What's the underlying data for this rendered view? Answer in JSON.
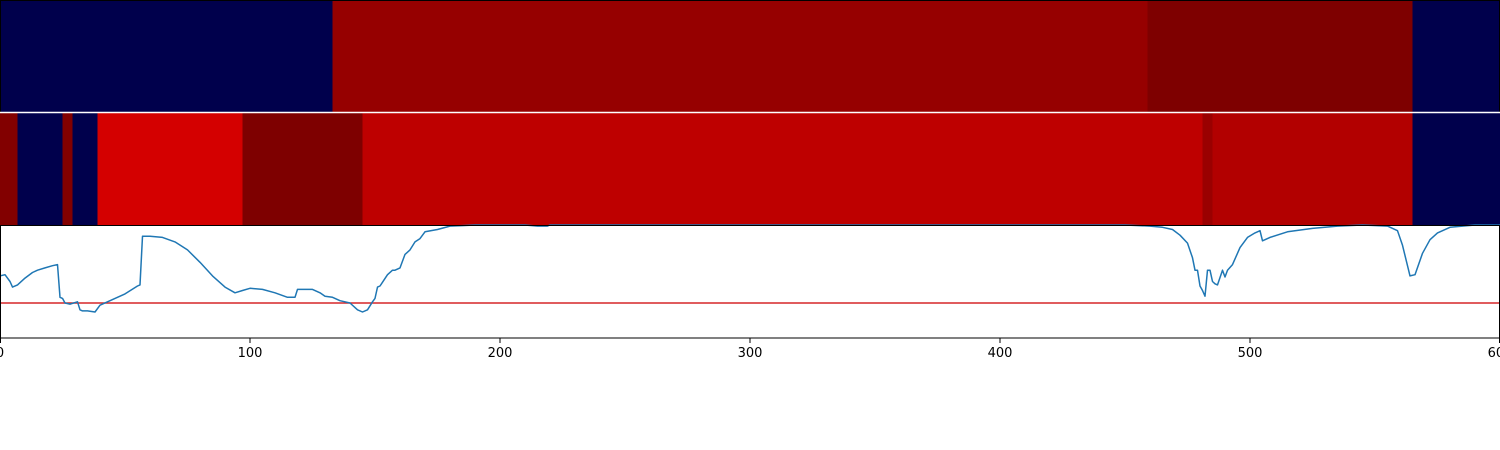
{
  "chart_data": [
    {
      "type": "heatmap",
      "panel": "top-strip",
      "xlim": [
        0,
        600
      ],
      "segments": [
        {
          "start": 0,
          "end": 133,
          "color": "#00004c"
        },
        {
          "start": 133,
          "end": 459,
          "color": "#960000"
        },
        {
          "start": 459,
          "end": 565,
          "color": "#7e0000"
        },
        {
          "start": 565,
          "end": 600,
          "color": "#00004c"
        }
      ]
    },
    {
      "type": "heatmap",
      "panel": "middle-strip",
      "xlim": [
        0,
        600
      ],
      "segments": [
        {
          "start": 0,
          "end": 7,
          "color": "#820000"
        },
        {
          "start": 7,
          "end": 25,
          "color": "#00004c"
        },
        {
          "start": 25,
          "end": 29,
          "color": "#820000"
        },
        {
          "start": 29,
          "end": 39,
          "color": "#00004c"
        },
        {
          "start": 39,
          "end": 97,
          "color": "#d40000"
        },
        {
          "start": 97,
          "end": 145,
          "color": "#7e0000"
        },
        {
          "start": 145,
          "end": 481,
          "color": "#be0000"
        },
        {
          "start": 481,
          "end": 485,
          "color": "#9a0000"
        },
        {
          "start": 485,
          "end": 565,
          "color": "#b20000"
        },
        {
          "start": 565,
          "end": 600,
          "color": "#00004c"
        }
      ]
    },
    {
      "type": "line",
      "panel": "bottom",
      "xlim": [
        0,
        600
      ],
      "ylim": [
        0,
        1
      ],
      "x_ticks": [
        0,
        100,
        200,
        300,
        400,
        500,
        600
      ],
      "line_color": "#1f77b4",
      "threshold": {
        "y": 0.31,
        "color": "#d62728"
      },
      "series": [
        {
          "x": [
            0,
            2,
            4,
            5,
            7,
            10,
            13,
            15,
            18,
            21,
            23,
            24,
            25,
            26,
            28,
            31,
            32,
            33,
            35,
            38,
            40,
            45,
            50,
            55,
            56,
            57,
            60,
            65,
            70,
            75,
            80,
            85,
            90,
            94,
            97,
            100,
            105,
            110,
            115,
            118,
            119,
            120,
            125,
            128,
            130,
            133,
            136,
            140,
            143,
            145,
            147,
            149,
            150,
            151,
            152,
            155,
            157,
            158,
            160,
            162,
            164,
            166,
            168,
            170,
            175,
            180,
            185,
            190,
            200,
            210,
            215,
            219,
            220,
            230,
            250,
            300,
            350,
            400,
            450,
            460,
            465,
            469,
            472,
            475,
            477,
            478,
            479,
            480,
            481,
            482,
            483,
            484,
            485,
            486,
            487,
            489,
            490,
            491,
            493,
            496,
            499,
            502,
            504,
            505,
            508,
            515,
            525,
            535,
            545,
            555,
            559,
            561,
            563,
            564,
            566,
            569,
            572,
            575,
            580,
            590,
            600
          ],
          "y": [
            0.55,
            0.56,
            0.5,
            0.45,
            0.47,
            0.53,
            0.58,
            0.6,
            0.62,
            0.64,
            0.65,
            0.36,
            0.35,
            0.31,
            0.3,
            0.32,
            0.25,
            0.24,
            0.24,
            0.23,
            0.29,
            0.34,
            0.39,
            0.46,
            0.47,
            0.9,
            0.9,
            0.89,
            0.85,
            0.78,
            0.67,
            0.55,
            0.45,
            0.4,
            0.42,
            0.44,
            0.43,
            0.4,
            0.36,
            0.36,
            0.43,
            0.43,
            0.43,
            0.4,
            0.37,
            0.36,
            0.33,
            0.31,
            0.25,
            0.23,
            0.25,
            0.32,
            0.35,
            0.45,
            0.46,
            0.56,
            0.6,
            0.6,
            0.62,
            0.74,
            0.78,
            0.85,
            0.88,
            0.94,
            0.96,
            0.99,
            0.995,
            1.0,
            1.0,
            1.0,
            0.99,
            0.99,
            1.0,
            1.0,
            1.0,
            1.0,
            1.0,
            1.0,
            1.0,
            0.99,
            0.98,
            0.96,
            0.91,
            0.84,
            0.71,
            0.6,
            0.6,
            0.46,
            0.42,
            0.37,
            0.6,
            0.6,
            0.5,
            0.48,
            0.47,
            0.6,
            0.54,
            0.6,
            0.65,
            0.8,
            0.89,
            0.93,
            0.95,
            0.86,
            0.89,
            0.94,
            0.97,
            0.99,
            1.0,
            0.99,
            0.95,
            0.82,
            0.64,
            0.55,
            0.56,
            0.75,
            0.87,
            0.93,
            0.98,
            1.0,
            1.0
          ]
        }
      ]
    }
  ]
}
